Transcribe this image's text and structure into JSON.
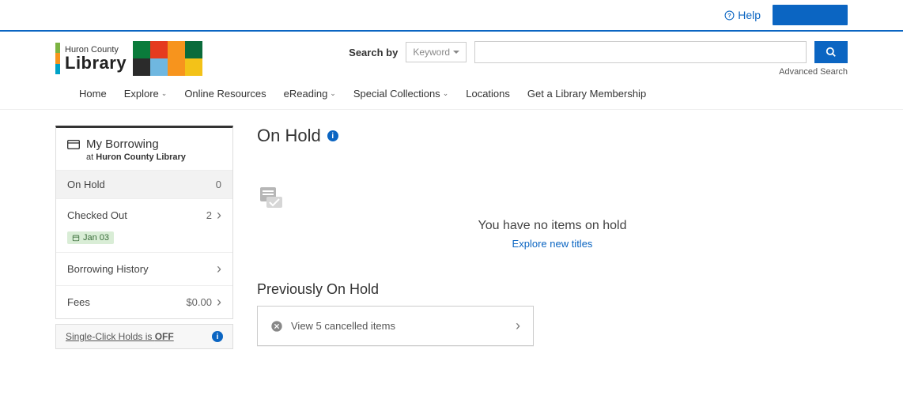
{
  "topbar": {
    "help": "Help"
  },
  "logo": {
    "county": "Huron County",
    "library": "Library"
  },
  "search": {
    "by_label": "Search by",
    "keyword": "Keyword",
    "advanced": "Advanced Search",
    "placeholder": ""
  },
  "nav": {
    "home": "Home",
    "explore": "Explore",
    "online_resources": "Online Resources",
    "ereading": "eReading",
    "special": "Special Collections",
    "locations": "Locations",
    "membership": "Get a Library Membership"
  },
  "sidebar": {
    "title": "My Borrowing",
    "at": "at",
    "library_name": "Huron County Library",
    "on_hold": {
      "label": "On Hold",
      "count": "0"
    },
    "checked_out": {
      "label": "Checked Out",
      "count": "2",
      "date": "Jan 03"
    },
    "history": {
      "label": "Borrowing History"
    },
    "fees": {
      "label": "Fees",
      "amount": "$0.00"
    },
    "single_click_prefix": "Single-Click Holds is ",
    "single_click_state": "OFF"
  },
  "content": {
    "title": "On Hold",
    "empty_msg": "You have no items on hold",
    "explore_link": "Explore new titles",
    "previously": "Previously On Hold",
    "cancelled": "View 5 cancelled items"
  }
}
